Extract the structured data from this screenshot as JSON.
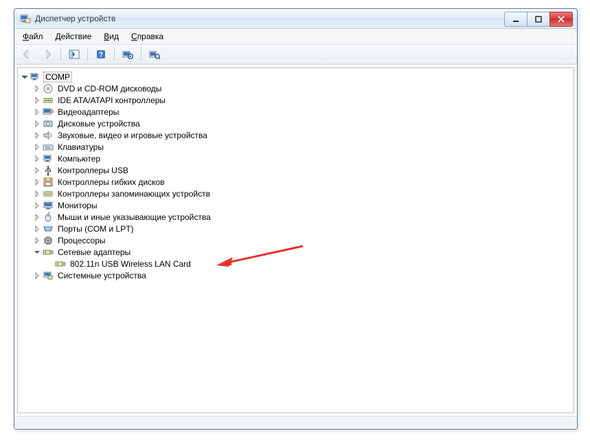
{
  "window": {
    "title": "Диспетчер устройств"
  },
  "menu": {
    "file": "Файл",
    "action": "Действие",
    "view": "Вид",
    "help": "Справка"
  },
  "tree": {
    "root": "COMP",
    "dvd": "DVD и CD-ROM дисководы",
    "ide": "IDE ATA/ATAPI контроллеры",
    "video": "Видеоадаптеры",
    "disk": "Дисковые устройства",
    "sound": "Звуковые, видео и игровые устройства",
    "keyboard": "Клавиатуры",
    "computer": "Компьютер",
    "usb": "Контроллеры USB",
    "floppy": "Контроллеры гибких дисков",
    "storage": "Контроллеры запоминающих устройств",
    "monitor": "Мониторы",
    "mouse": "Мыши и иные указывающие устройства",
    "ports": "Порты (COM и LPT)",
    "cpu": "Процессоры",
    "network": "Сетевые адаптеры",
    "network_child": "802.11n USB Wireless LAN Card",
    "system": "Системные устройства"
  },
  "colors": {
    "arrow": "#e8332c"
  }
}
